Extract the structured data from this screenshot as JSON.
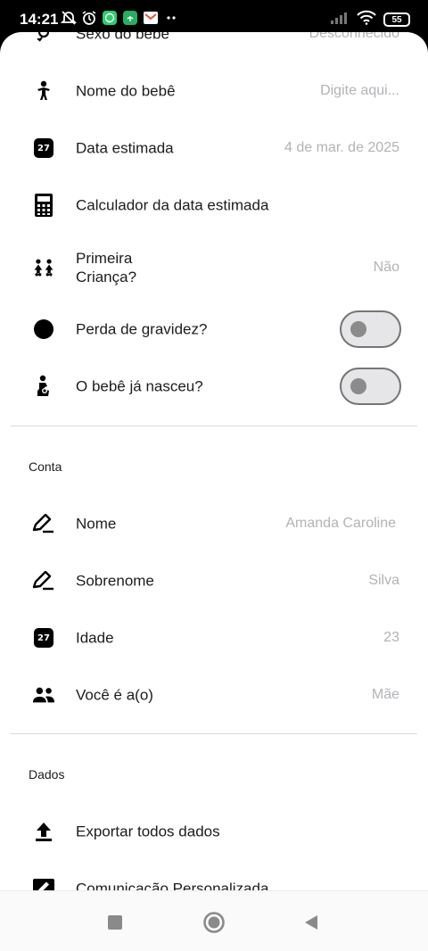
{
  "status_bar": {
    "time": "14:21",
    "battery": "55",
    "icons": [
      "silent-alarm-icon",
      "alarm-icon",
      "whatsapp-icon",
      "signal-app-icon",
      "gmail-icon",
      "more-dots-icon"
    ],
    "right_icons": [
      "cellular-signal-icon",
      "wifi-icon",
      "battery-icon"
    ]
  },
  "baby_section": {
    "rows": [
      {
        "label": "Sexo do bebê",
        "value": "Desconhecido",
        "icon": "gender-icon"
      },
      {
        "label": "Nome do bebê",
        "value": "Digite aqui...",
        "icon": "baby-icon"
      },
      {
        "label": "Data estimada",
        "value": "4 de mar. de 2025",
        "icon": "calendar-icon",
        "badge": "27"
      },
      {
        "label": "Calculador da data estimada",
        "value": "",
        "icon": "calculator-icon"
      },
      {
        "label": "Primeira\nCriança?",
        "value": "Não",
        "icon": "children-icon"
      },
      {
        "label": "Perda de gravidez?",
        "icon": "circle-icon",
        "toggle": false
      },
      {
        "label": "O bebê já nasceu?",
        "icon": "mother-baby-icon",
        "toggle": false
      }
    ]
  },
  "account_section": {
    "title": "Conta",
    "rows": [
      {
        "label": "Nome",
        "value": "Amanda Caroline",
        "icon": "pen-icon"
      },
      {
        "label": "Sobrenome",
        "value": "Silva",
        "icon": "pen-icon"
      },
      {
        "label": "Idade",
        "value": "23",
        "icon": "calendar-icon",
        "badge": "27"
      },
      {
        "label": "Você é a(o)",
        "value": "Mãe",
        "icon": "people-icon"
      }
    ]
  },
  "data_section": {
    "title": "Dados",
    "rows": [
      {
        "label": "Exportar todos dados",
        "icon": "upload-icon"
      },
      {
        "label": "Comunicação Personalizada",
        "icon": "edit-box-icon"
      }
    ]
  },
  "nav_bar": {
    "buttons": [
      "recents-square-icon",
      "home-circle-icon",
      "back-triangle-icon"
    ]
  }
}
